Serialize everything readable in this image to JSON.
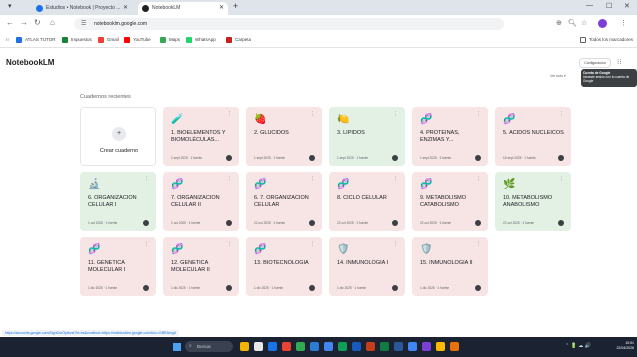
{
  "browser": {
    "tabs": [
      {
        "label": "Estudios • Notebook | Proyecto ...",
        "active": false
      },
      {
        "label": "NotebookLM",
        "active": true
      }
    ],
    "address": "notebooklm.google.com",
    "bookmarks": [
      {
        "label": "ATLAS TUTOR",
        "color": "#1a73e8"
      },
      {
        "label": "Impuestos",
        "color": "#188038"
      },
      {
        "label": "Gmail",
        "color": "#ea4335"
      },
      {
        "label": "YouTube",
        "color": "#ff0000"
      },
      {
        "label": "Maps",
        "color": "#34a853"
      },
      {
        "label": "WhatsApp",
        "color": "#25d366"
      },
      {
        "label": "Carpeta",
        "color": "#c5221f"
      }
    ],
    "bookmarks_right": "Todos los marcadores"
  },
  "app": {
    "logo": "NotebookLM",
    "settings_label": "Configuración",
    "tooltip_title": "Cuenta de Google",
    "tooltip_body": "Iniciaste sesión con tu cuenta de Google",
    "view_sort": "Ver todo"
  },
  "section_title": "Cuadernos recientes",
  "create_label": "Crear cuaderno",
  "notebooks": [
    {
      "emoji": "🧪",
      "title": "1. BIOELEMENTOS Y BIOMOLÉCULAS...",
      "meta": "1 sept 2025 · 1 fuente",
      "color": "#f7e4e4"
    },
    {
      "emoji": "🍓",
      "title": "2. GLÚCIDOS",
      "meta": "1 sept 2025 · 1 fuente",
      "color": "#f7e4e4"
    },
    {
      "emoji": "🍋",
      "title": "3. LÍPIDOS",
      "meta": "1 sept 2025 · 1 fuente",
      "color": "#e2f1e4"
    },
    {
      "emoji": "🧬",
      "title": "4. PROTEÍNAS, ENZIMAS Y...",
      "meta": "1 sept 2025 · 1 fuente",
      "color": "#f7e4e4"
    },
    {
      "emoji": "🧬",
      "title": "5. ÁCIDOS NUCLEICOS",
      "meta": "16 sept 2025 · 1 fuente",
      "color": "#f7e4e4"
    },
    {
      "emoji": "🔬",
      "title": "6. ORGANIZACIÓN CELULAR I",
      "meta": "1 oct 2025 · 1 fuente",
      "color": "#e2f1e4"
    },
    {
      "emoji": "🧬",
      "title": "7. ORGANIZACIÓN CELULAR II",
      "meta": "1 oct 2025 · 1 fuente",
      "color": "#f7e4e4"
    },
    {
      "emoji": "🧬",
      "title": "6. 7. ORGANIZACIÓN CELULAR",
      "meta": "22 oct 2025 · 1 fuente",
      "color": "#f7e4e4"
    },
    {
      "emoji": "🧬",
      "title": "8. CICLO CELULAR",
      "meta": "22 oct 2025 · 1 fuente",
      "color": "#f7e4e4"
    },
    {
      "emoji": "🧬",
      "title": "9. METABOLISMO CATABOLISMO",
      "meta": "22 oct 2025 · 1 fuente",
      "color": "#f7e4e4"
    },
    {
      "emoji": "🌿",
      "title": "10. METABOLISMO ANABOLISMO",
      "meta": "22 oct 2025 · 1 fuente",
      "color": "#e2f1e4"
    },
    {
      "emoji": "🧬",
      "title": "11. GENÉTICA MOLECULAR I",
      "meta": "1 dic 2025 · 1 fuente",
      "color": "#f7e4e4"
    },
    {
      "emoji": "🧬",
      "title": "12. GENÉTICA MOLECULAR II",
      "meta": "1 dic 2025 · 1 fuente",
      "color": "#f7e4e4"
    },
    {
      "emoji": "🧬",
      "title": "13. BIOTECNOLOGÍA",
      "meta": "1 dic 2025 · 1 fuente",
      "color": "#f7e4e4"
    },
    {
      "emoji": "🛡️",
      "title": "14. INMUNOLOGÍA I",
      "meta": "1 dic 2025 · 1 fuente",
      "color": "#f7e4e4"
    },
    {
      "emoji": "🛡️",
      "title": "15. INMUNOLOGÍA II",
      "meta": "1 dic 2025 · 1 fuente",
      "color": "#f7e4e4"
    }
  ],
  "status_link": "https://accounts.google.com/SignOutOptions?hl=es&continue=https://notebooklm.google.com/&ec=GBRAmgU",
  "taskbar": {
    "search_placeholder": "Buscar",
    "time": "15:51",
    "date": "22/04/2026"
  }
}
